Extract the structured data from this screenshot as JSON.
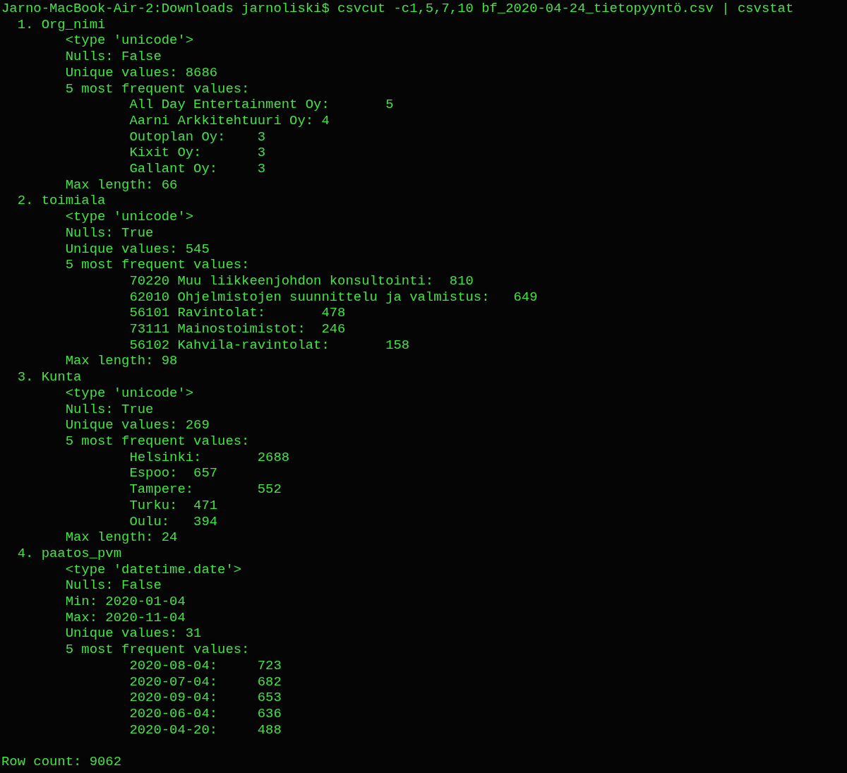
{
  "prompt": "Jarno-MacBook-Air-2:Downloads jarnoliski$ csvcut -c1,5,7,10 bf_2020-04-24_tietopyyntö.csv | csvstat",
  "columns": [
    {
      "index": "1.",
      "name": "Org_nimi",
      "stats_before": [
        "<type 'unicode'>",
        "Nulls: False",
        "Unique values: 8686"
      ],
      "frequent_heading": "5 most frequent values:",
      "frequent": [
        {
          "label": "All Day Entertainment Oy:",
          "count": "5"
        },
        {
          "label": "Aarni Arkkitehtuuri Oy:",
          "count": "4"
        },
        {
          "label": "Outoplan Oy:",
          "count": "3"
        },
        {
          "label": "Kixit Oy:",
          "count": "3"
        },
        {
          "label": "Gallant Oy:",
          "count": "3"
        }
      ],
      "stats_after": [
        "Max length: 66"
      ]
    },
    {
      "index": "2.",
      "name": "toimiala",
      "stats_before": [
        "<type 'unicode'>",
        "Nulls: True",
        "Unique values: 545"
      ],
      "frequent_heading": "5 most frequent values:",
      "frequent": [
        {
          "label": "70220 Muu liikkeenjohdon konsultointi:",
          "count": "810"
        },
        {
          "label": "62010 Ohjelmistojen suunnittelu ja valmistus:",
          "count": "649"
        },
        {
          "label": "56101 Ravintolat:",
          "count": "478"
        },
        {
          "label": "73111 Mainostoimistot:",
          "count": "246"
        },
        {
          "label": "56102 Kahvila-ravintolat:",
          "count": "158"
        }
      ],
      "stats_after": [
        "Max length: 98"
      ]
    },
    {
      "index": "3.",
      "name": "Kunta",
      "stats_before": [
        "<type 'unicode'>",
        "Nulls: True",
        "Unique values: 269"
      ],
      "frequent_heading": "5 most frequent values:",
      "frequent": [
        {
          "label": "Helsinki:",
          "count": "2688"
        },
        {
          "label": "Espoo:",
          "count": "657"
        },
        {
          "label": "Tampere:",
          "count": "552"
        },
        {
          "label": "Turku:",
          "count": "471"
        },
        {
          "label": "Oulu:",
          "count": "394"
        }
      ],
      "stats_after": [
        "Max length: 24"
      ]
    },
    {
      "index": "4.",
      "name": "paatos_pvm",
      "stats_before": [
        "<type 'datetime.date'>",
        "Nulls: False",
        "Min: 2020-01-04",
        "Max: 2020-11-04",
        "Unique values: 31"
      ],
      "frequent_heading": "5 most frequent values:",
      "frequent": [
        {
          "label": "2020-08-04:",
          "count": "723"
        },
        {
          "label": "2020-07-04:",
          "count": "682"
        },
        {
          "label": "2020-09-04:",
          "count": "653"
        },
        {
          "label": "2020-06-04:",
          "count": "636"
        },
        {
          "label": "2020-04-20:",
          "count": "488"
        }
      ]
    }
  ],
  "row_count": "Row count: 9062"
}
